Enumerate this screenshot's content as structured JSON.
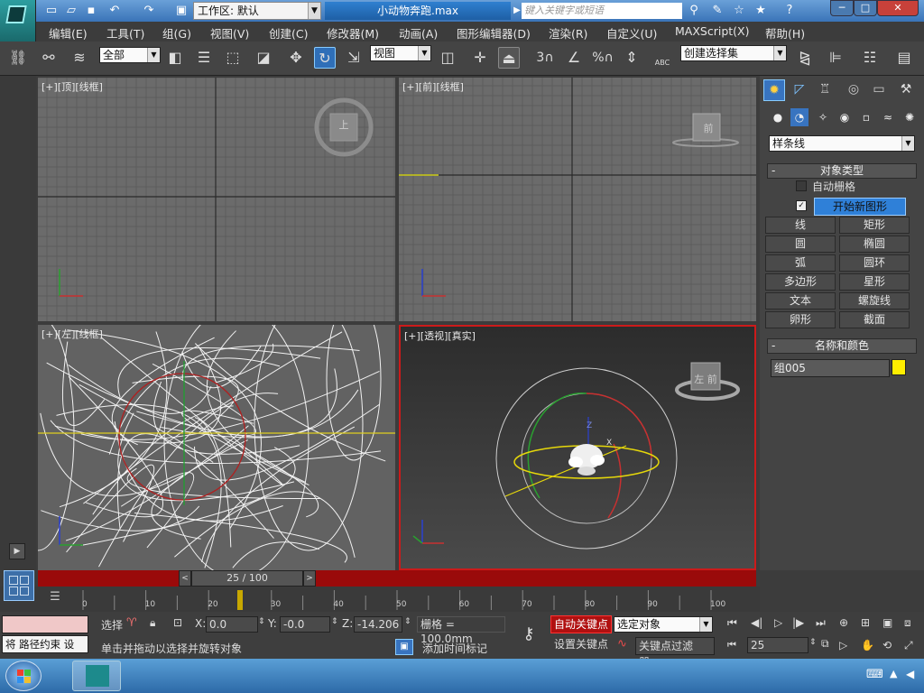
{
  "title_bar": {
    "workspace_label": "工作区: 默认",
    "file_title": "小动物奔跑.max",
    "search_placeholder": "键入关键字或短语"
  },
  "menu": [
    "编辑(E)",
    "工具(T)",
    "组(G)",
    "视图(V)",
    "创建(C)",
    "修改器(M)",
    "动画(A)",
    "图形编辑器(D)",
    "渲染(R)",
    "自定义(U)",
    "MAXScript(X)",
    "帮助(H)"
  ],
  "toolbar": {
    "selection_filter": "全部",
    "ref_coord": "视图",
    "named_selection": "创建选择集",
    "snap_label": "3",
    "percent_label": "%",
    "abc_label": "ABC"
  },
  "viewports": {
    "top": {
      "label": "[+][顶][线框]",
      "cube_text": "上"
    },
    "front": {
      "label": "[+][前][线框]",
      "cube_text": "前"
    },
    "left": {
      "label": "[+][左][线框]"
    },
    "perspective": {
      "label": "[+][透视][真实]",
      "cube_text": "左  前"
    },
    "axis_z": "Z",
    "axis_x": "X"
  },
  "command_panel": {
    "category_dropdown": "样条线",
    "object_type_header": "对象类型",
    "autogrid_label": "自动栅格",
    "start_new_shape_label": "开始新图形",
    "buttons": [
      "线",
      "矩形",
      "圆",
      "椭圆",
      "弧",
      "圆环",
      "多边形",
      "星形",
      "文本",
      "螺旋线",
      "卵形",
      "截面"
    ],
    "name_color_header": "名称和颜色",
    "object_name": "组005",
    "object_color": "#ffee00"
  },
  "timeline": {
    "frame_display": "25 / 100",
    "current_frame": 25,
    "total_frames": 100,
    "ticks": [
      "0",
      "10",
      "20",
      "30",
      "40",
      "50",
      "60",
      "70",
      "80",
      "90",
      "100"
    ]
  },
  "status_bar": {
    "maxscript_text": "将 路径约束 设",
    "select_label": "选择",
    "x_label": "X:",
    "x_value": "0.0",
    "y_label": "Y:",
    "y_value": "-0.0",
    "z_label": "Z:",
    "z_value": "-14.206",
    "grid_label": "栅格 = 100.0mm",
    "prompt": "单击并拖动以选择并旋转对象",
    "add_time_tag": "添加时间标记",
    "auto_key": "自动关键点",
    "set_key": "设置关键点",
    "selected_object": "选定对象",
    "key_filters": "关键点过滤器...",
    "frame_field": "25"
  },
  "colors": {
    "active_viewport_border": "#cc1a1a",
    "time_slider": "#9a0a0a",
    "auto_key_button": "#b01010",
    "highlight_blue": "#2f80d8"
  }
}
